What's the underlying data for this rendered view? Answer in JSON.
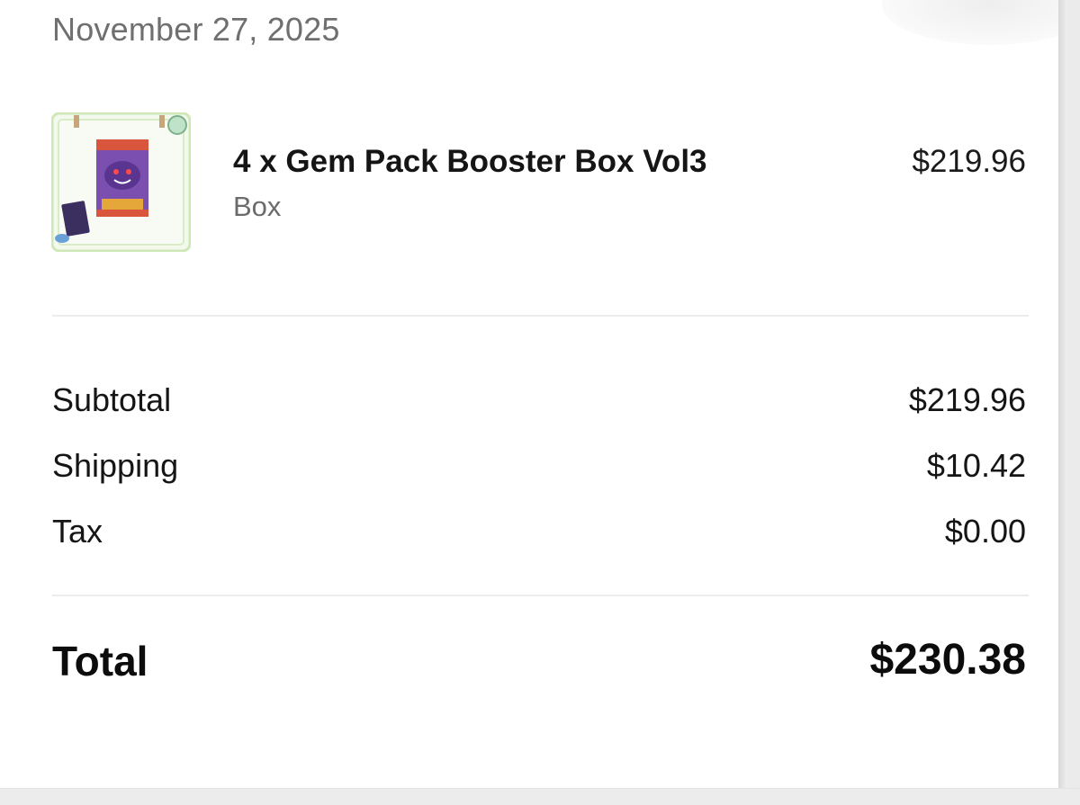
{
  "order": {
    "date": "November 27, 2025"
  },
  "item": {
    "name": "4 x Gem Pack Booster Box Vol3",
    "variant": "Box",
    "price": "$219.96",
    "image_icon": "booster-pack-thumbnail-icon"
  },
  "summary": {
    "subtotal_label": "Subtotal",
    "subtotal_value": "$219.96",
    "shipping_label": "Shipping",
    "shipping_value": "$10.42",
    "tax_label": "Tax",
    "tax_value": "$0.00",
    "total_label": "Total",
    "total_value": "$230.38"
  },
  "colors": {
    "thumbnail_frame": "#cfe8b8",
    "pack_purple": "#7a4fb0",
    "pack_red": "#d9553c"
  }
}
